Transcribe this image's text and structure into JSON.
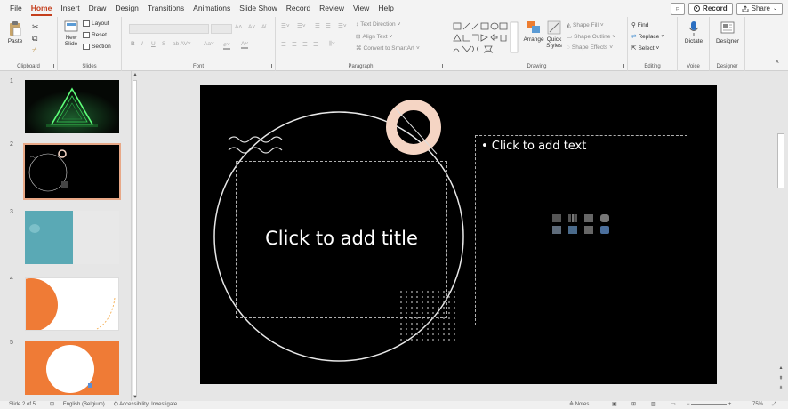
{
  "tabs": [
    "File",
    "Home",
    "Insert",
    "Draw",
    "Design",
    "Transitions",
    "Animations",
    "Slide Show",
    "Record",
    "Review",
    "View",
    "Help"
  ],
  "active_tab": "Home",
  "topright": {
    "record_label": "Record",
    "share_label": "Share"
  },
  "ribbon": {
    "clipboard": {
      "label": "Clipboard",
      "paste": "Paste"
    },
    "slides": {
      "label": "Slides",
      "new_slide": "New",
      "new_slide2": "Slide",
      "layout": "Layout",
      "reset": "Reset",
      "section": "Section"
    },
    "font": {
      "label": "Font",
      "bold": "B",
      "italic": "I",
      "underline": "U",
      "strike": "S"
    },
    "paragraph": {
      "label": "Paragraph",
      "text_direction": "Text Direction",
      "align_text": "Align Text",
      "convert_smartart": "Convert to SmartArt"
    },
    "drawing": {
      "label": "Drawing",
      "arrange": "Arrange",
      "quick_styles": "Quick",
      "quick_styles2": "Styles",
      "shape_fill": "Shape Fill",
      "shape_outline": "Shape Outline",
      "shape_effects": "Shape Effects"
    },
    "editing": {
      "label": "Editing",
      "find": "Find",
      "replace": "Replace",
      "select": "Select"
    },
    "voice": {
      "label": "Voice",
      "dictate": "Dictate"
    },
    "designer": {
      "label": "Designer",
      "designer_btn": "Designer"
    }
  },
  "slides": [
    {
      "num": "1",
      "style": "dark-neon"
    },
    {
      "num": "2",
      "style": "dark-circle",
      "selected": true
    },
    {
      "num": "3",
      "style": "teal-grey"
    },
    {
      "num": "4",
      "style": "orange-arc"
    },
    {
      "num": "5",
      "style": "orange-circle"
    }
  ],
  "slide": {
    "title_placeholder": "Click to add title",
    "content_placeholder": "• Click to add text"
  },
  "status": {
    "slide_of": "Slide 2 of 5",
    "language": "English (Belgium)",
    "accessibility": "Accessibility: Investigate",
    "notes": "Notes",
    "zoom": "75%"
  },
  "colors": {
    "accent": "#c43e1c",
    "peach": "#f5d5c4",
    "orange": "#ef7b36",
    "teal": "#5aa9b5"
  }
}
